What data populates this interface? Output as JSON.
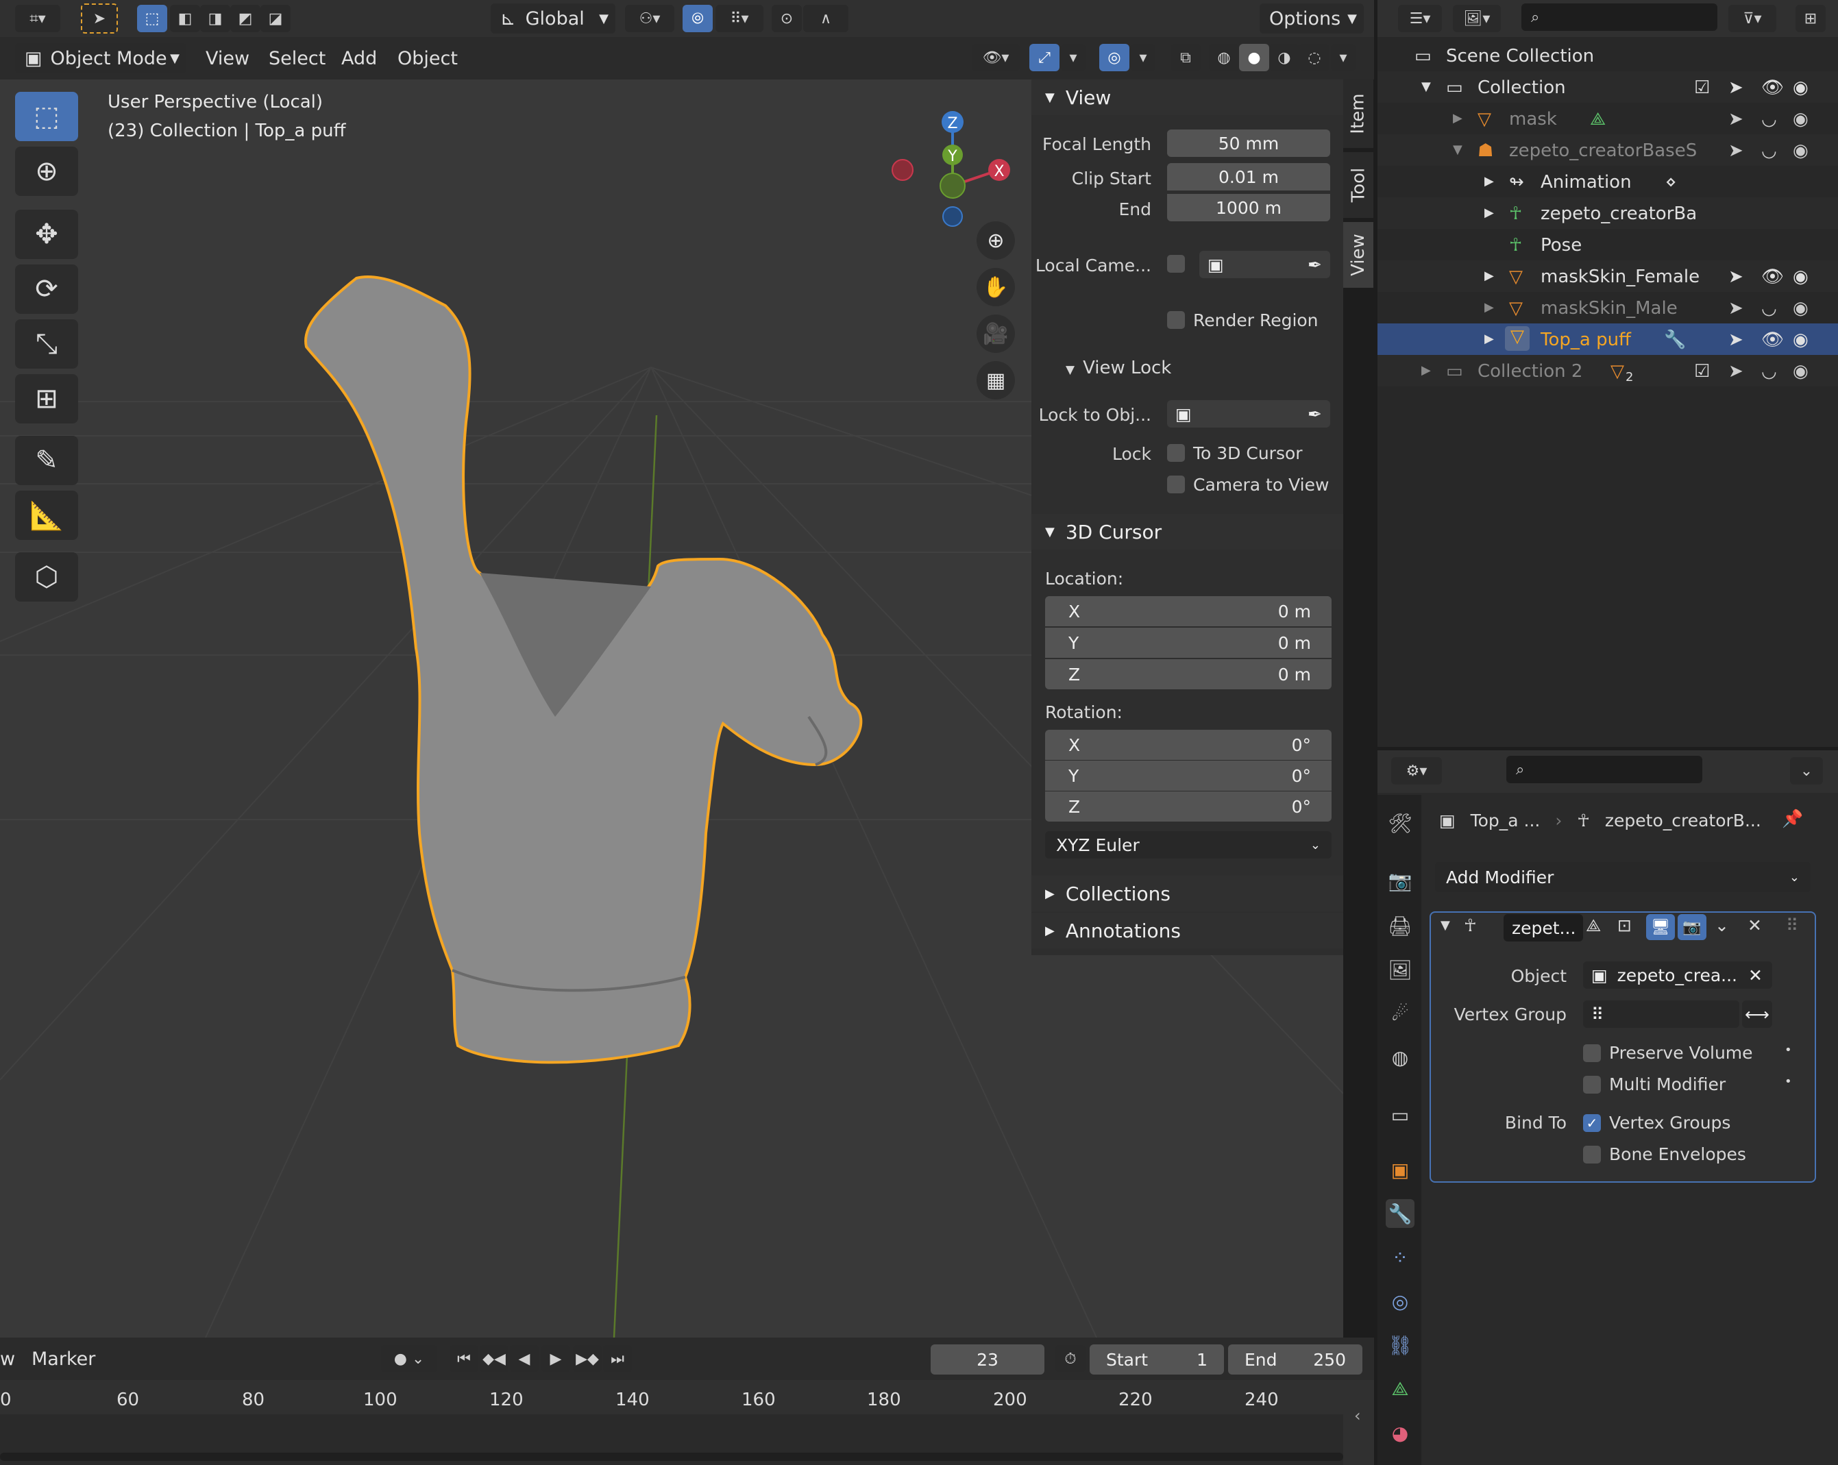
{
  "header": {
    "orientation_label": "Global",
    "options_label": "Options",
    "mode_label": "Object Mode",
    "menus": [
      "View",
      "Select",
      "Add",
      "Object"
    ]
  },
  "viewport": {
    "perspective_label": "User Perspective (Local)",
    "collection_label": "(23) Collection | Top_a puff",
    "gizmo_axes": [
      "Z",
      "Y",
      "X"
    ]
  },
  "npanel": {
    "tabs": [
      "Item",
      "Tool",
      "View"
    ],
    "view_section": {
      "title": "View",
      "focal_length_label": "Focal Length",
      "focal_length": "50 mm",
      "clip_start_label": "Clip Start",
      "clip_start": "0.01 m",
      "end_label": "End",
      "end": "1000 m",
      "local_camera_label": "Local Came...",
      "render_region_label": "Render Region"
    },
    "view_lock": {
      "title": "View Lock",
      "lock_to_obj_label": "Lock to Obj...",
      "lock_label": "Lock",
      "to_3d_cursor_label": "To 3D Cursor",
      "camera_to_view_label": "Camera to View"
    },
    "cursor_section": {
      "title": "3D Cursor",
      "location_label": "Location:",
      "location": [
        {
          "axis": "X",
          "value": "0 m"
        },
        {
          "axis": "Y",
          "value": "0 m"
        },
        {
          "axis": "Z",
          "value": "0 m"
        }
      ],
      "rotation_label": "Rotation:",
      "rotation": [
        {
          "axis": "X",
          "value": "0°"
        },
        {
          "axis": "Y",
          "value": "0°"
        },
        {
          "axis": "Z",
          "value": "0°"
        }
      ],
      "rotation_mode": "XYZ Euler"
    },
    "collapsed_sections": [
      "Collections",
      "Annotations"
    ]
  },
  "outliner": {
    "scene_collection": "Scene Collection",
    "rows": [
      {
        "label": "Collection"
      },
      {
        "label": "mask"
      },
      {
        "label": "zepeto_creatorBaseS"
      },
      {
        "label": "Animation"
      },
      {
        "label": "zepeto_creatorBa"
      },
      {
        "label": "Pose"
      },
      {
        "label": "maskSkin_Female"
      },
      {
        "label": "maskSkin_Male"
      },
      {
        "label": "Top_a puff"
      },
      {
        "label": "Collection 2"
      }
    ],
    "collection2_badge": "2"
  },
  "properties": {
    "object_short": "Top_a ...",
    "armature_short": "zepeto_creatorB...",
    "add_modifier_label": "Add Modifier",
    "modifier_name": "zepet...",
    "object_label": "Object",
    "object_value": "zepeto_crea...",
    "vertex_group_label": "Vertex Group",
    "preserve_volume_label": "Preserve Volume",
    "multi_modifier_label": "Multi Modifier",
    "bind_to_label": "Bind To",
    "vertex_groups_label": "Vertex Groups",
    "bone_envelopes_label": "Bone Envelopes"
  },
  "timeline": {
    "marker_label": "Marker",
    "current_frame": "23",
    "start_label": "Start",
    "start_value": "1",
    "end_label": "End",
    "end_value": "250",
    "ruler": [
      "0",
      "60",
      "80",
      "100",
      "120",
      "140",
      "160",
      "180",
      "200",
      "220",
      "240"
    ],
    "left_cut_label": "w"
  },
  "colors": {
    "accent": "#4772b3",
    "selection_outline": "#f5a623",
    "axis_x": "#c8384d",
    "axis_y": "#6a9e2f",
    "axis_z": "#3a79c9"
  }
}
